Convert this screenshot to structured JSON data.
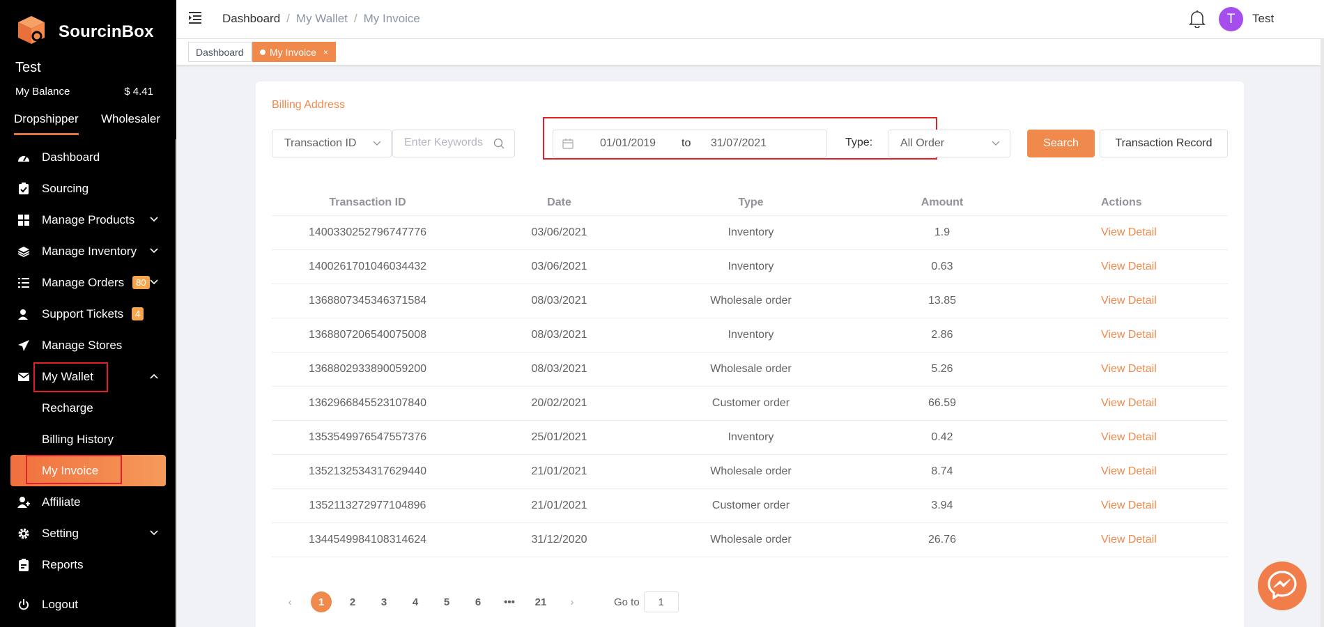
{
  "brand": {
    "name": "SourcinBox",
    "accent": "#f0894c",
    "danger_outline": "#e0202a"
  },
  "sidebar": {
    "user_name": "Test",
    "balance_label": "My Balance",
    "balance_value": "$ 4.41",
    "roles": [
      {
        "label": "Dropshipper",
        "active": true
      },
      {
        "label": "Wholesaler",
        "active": false
      }
    ],
    "items": [
      {
        "label": "Dashboard",
        "icon": "dashboard-icon"
      },
      {
        "label": "Sourcing",
        "icon": "clipboard-check-icon"
      },
      {
        "label": "Manage Products",
        "icon": "grid-icon",
        "expand": "chevron-down"
      },
      {
        "label": "Manage Inventory",
        "icon": "layers-icon",
        "expand": "chevron-down"
      },
      {
        "label": "Manage Orders",
        "icon": "list-icon",
        "badge": "80",
        "expand": "chevron-down"
      },
      {
        "label": "Support Tickets",
        "icon": "support-icon",
        "badge": "4"
      },
      {
        "label": "Manage Stores",
        "icon": "paper-plane-icon"
      },
      {
        "label": "My Wallet",
        "icon": "envelope-icon",
        "expand": "chevron-up"
      },
      {
        "label": "Recharge"
      },
      {
        "label": "Billing History"
      },
      {
        "label": "My Invoice",
        "active": true
      },
      {
        "label": "Affiliate",
        "icon": "user-plus-icon"
      },
      {
        "label": "Setting",
        "icon": "gear-icon",
        "expand": "chevron-down"
      },
      {
        "label": "Reports",
        "icon": "report-icon"
      }
    ],
    "logout": "Logout"
  },
  "header": {
    "breadcrumb": [
      "Dashboard",
      "My Wallet",
      "My Invoice"
    ],
    "user": "Test",
    "avatar_letter": "T"
  },
  "tabs": [
    {
      "label": "Dashboard"
    },
    {
      "label": "My Invoice",
      "active": true,
      "close": "×"
    }
  ],
  "card": {
    "title": "Billing Address",
    "filters": {
      "search_field": "Transaction ID",
      "keyword_placeholder": "Enter Keywords",
      "date_from": "01/01/2019",
      "date_sep": "to",
      "date_to": "31/07/2021",
      "type_label": "Type:",
      "type_value": "All Order",
      "search_button": "Search",
      "record_button": "Transaction Record"
    },
    "table": {
      "headers": [
        "Transaction ID",
        "Date",
        "Type",
        "Amount",
        "Actions"
      ],
      "rows": [
        [
          "1400330252796747776",
          "03/06/2021",
          "Inventory",
          "1.9",
          "View Detail"
        ],
        [
          "1400261701046034432",
          "03/06/2021",
          "Inventory",
          "0.63",
          "View Detail"
        ],
        [
          "1368807345346371584",
          "08/03/2021",
          "Wholesale order",
          "13.85",
          "View Detail"
        ],
        [
          "1368807206540075008",
          "08/03/2021",
          "Inventory",
          "2.86",
          "View Detail"
        ],
        [
          "1368802933890059200",
          "08/03/2021",
          "Wholesale order",
          "5.26",
          "View Detail"
        ],
        [
          "1362966845523107840",
          "20/02/2021",
          "Customer order",
          "66.59",
          "View Detail"
        ],
        [
          "1353549976547557376",
          "25/01/2021",
          "Inventory",
          "0.42",
          "View Detail"
        ],
        [
          "1352132534317629440",
          "21/01/2021",
          "Wholesale order",
          "8.74",
          "View Detail"
        ],
        [
          "1352113272977104896",
          "21/01/2021",
          "Customer order",
          "3.94",
          "View Detail"
        ],
        [
          "1344549984108314624",
          "31/12/2020",
          "Wholesale order",
          "26.76",
          "View Detail"
        ]
      ]
    },
    "pagination": {
      "prev": "‹",
      "pages": [
        "1",
        "2",
        "3",
        "4",
        "5",
        "6",
        "•••",
        "21"
      ],
      "current": "1",
      "next": "›",
      "goto_label": "Go to",
      "goto_value": "1"
    }
  }
}
